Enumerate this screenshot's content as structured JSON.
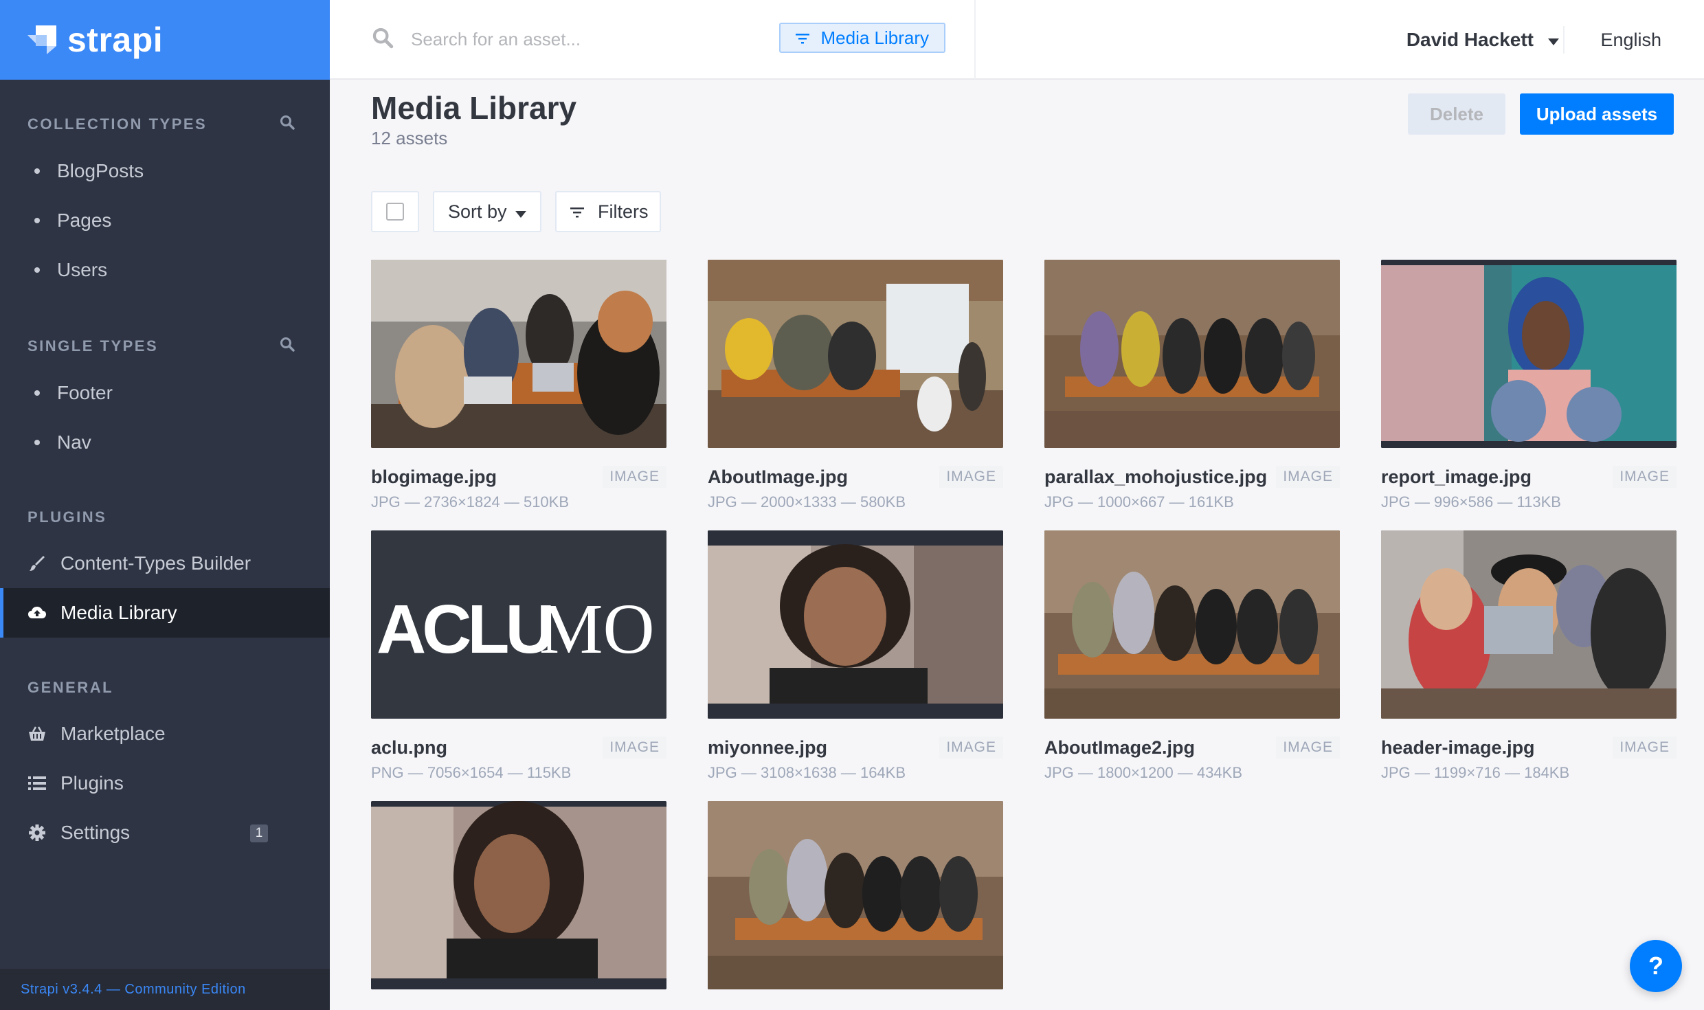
{
  "brand": {
    "name": "strapi",
    "color": "#3b88f7"
  },
  "sidebar": {
    "sections": [
      {
        "title": "Collection Types",
        "items": [
          "BlogPosts",
          "Pages",
          "Users"
        ]
      },
      {
        "title": "Single Types",
        "items": [
          "Footer",
          "Nav"
        ]
      }
    ],
    "plugins_title": "Plugins",
    "plugins": [
      {
        "label": "Content-Types Builder",
        "icon": "paintbrush-icon"
      },
      {
        "label": "Media Library",
        "icon": "cloud-upload-icon",
        "active": true
      }
    ],
    "general_title": "General",
    "general": [
      {
        "label": "Marketplace",
        "icon": "basket-icon"
      },
      {
        "label": "Plugins",
        "icon": "list-icon"
      },
      {
        "label": "Settings",
        "icon": "gear-icon",
        "badge": "1"
      }
    ],
    "version": "Strapi v3.4.4 — Community Edition"
  },
  "header": {
    "search_placeholder": "Search for an asset...",
    "scope": "Media Library",
    "user": "David Hackett",
    "language": "English"
  },
  "main": {
    "title": "Media Library",
    "subtitle": "12 assets",
    "delete_label": "Delete",
    "upload_label": "Upload assets",
    "sort_label": "Sort by",
    "filters_label": "Filters"
  },
  "assets": [
    {
      "name": "blogimage.jpg",
      "type": "IMAGE",
      "meta": "JPG — 2736×1824 — 510KB"
    },
    {
      "name": "AboutImage.jpg",
      "type": "IMAGE",
      "meta": "JPG — 2000×1333 — 580KB"
    },
    {
      "name": "parallax_mohojustice.jpg",
      "type": "IMAGE",
      "meta": "JPG — 1000×667 — 161KB"
    },
    {
      "name": "report_image.jpg",
      "type": "IMAGE",
      "meta": "JPG — 996×586 — 113KB"
    },
    {
      "name": "aclu.png",
      "type": "IMAGE",
      "meta": "PNG — 7056×1654 — 115KB",
      "logo_text": "ACLUMO"
    },
    {
      "name": "miyonnee.jpg",
      "type": "IMAGE",
      "meta": "JPG — 3108×1638 — 164KB"
    },
    {
      "name": "AboutImage2.jpg",
      "type": "IMAGE",
      "meta": "JPG — 1800×1200 — 434KB"
    },
    {
      "name": "header-image.jpg",
      "type": "IMAGE",
      "meta": "JPG — 1199×716 — 184KB"
    },
    {
      "name": "",
      "type": "",
      "meta": ""
    },
    {
      "name": "",
      "type": "",
      "meta": ""
    }
  ],
  "help_label": "?"
}
